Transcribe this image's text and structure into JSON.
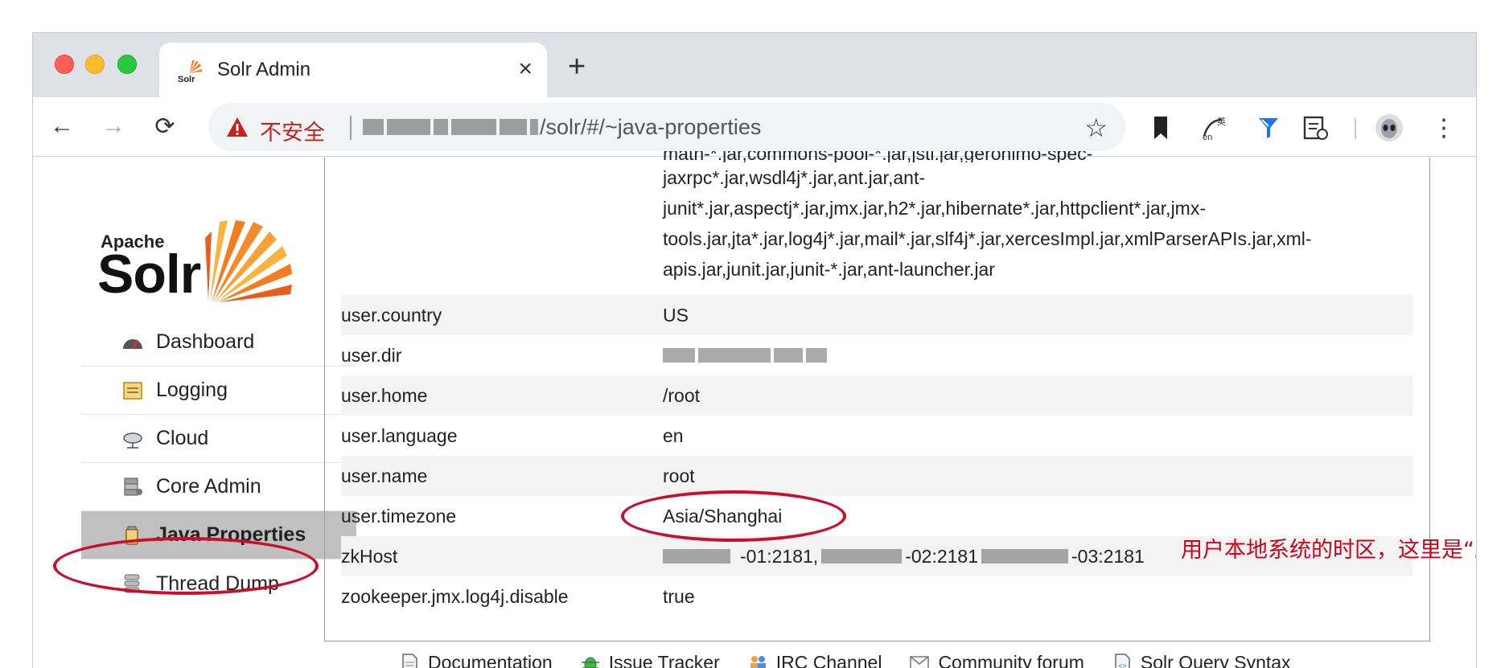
{
  "tab": {
    "title": "Solr Admin",
    "close": "×",
    "new": "+"
  },
  "omnibox": {
    "insecure_label": "不安全",
    "url_path": "/solr/#/~java-properties"
  },
  "toolbar": {
    "back": "←",
    "forward": "→",
    "reload": "⟳",
    "star": "☆",
    "menu": "⋮"
  },
  "logo": {
    "apache": "Apache",
    "solr": "Solr"
  },
  "menu": {
    "items": [
      {
        "label": "Dashboard",
        "icon": "dashboard-icon"
      },
      {
        "label": "Logging",
        "icon": "logging-icon"
      },
      {
        "label": "Cloud",
        "icon": "cloud-icon"
      },
      {
        "label": "Core Admin",
        "icon": "core-admin-icon"
      },
      {
        "label": "Java Properties",
        "icon": "java-properties-icon",
        "active": true
      },
      {
        "label": "Thread Dump",
        "icon": "thread-dump-icon"
      }
    ]
  },
  "properties": {
    "continued_lines": [
      "math-*.jar,commons-pool-*.jar,jstl.jar,geronimo-spec-",
      "jaxrpc*.jar,wsdl4j*.jar,ant.jar,ant-",
      "junit*.jar,aspectj*.jar,jmx.jar,h2*.jar,hibernate*.jar,httpclient*.jar,jmx-",
      "tools.jar,jta*.jar,log4j*.jar,mail*.jar,slf4j*.jar,xercesImpl.jar,xmlParserAPIs.jar,xml-",
      "apis.jar,junit.jar,junit-*.jar,ant-launcher.jar"
    ],
    "rows": [
      {
        "key": "user.country",
        "value": "US"
      },
      {
        "key": "user.dir",
        "value": ""
      },
      {
        "key": "user.home",
        "value": "/root"
      },
      {
        "key": "user.language",
        "value": "en"
      },
      {
        "key": "user.name",
        "value": "root"
      },
      {
        "key": "user.timezone",
        "value": "Asia/Shanghai"
      },
      {
        "key": "zkHost",
        "value": "",
        "parts": [
          "-01:2181,",
          "-02:2181",
          "-03:2181"
        ]
      },
      {
        "key": "zookeeper.jmx.log4j.disable",
        "value": "true"
      }
    ]
  },
  "annotation": {
    "text": "用户本地系统的时区，这里是“亚洲/上海”",
    "color": "#d0021b"
  },
  "footer": {
    "links": [
      {
        "label": "Documentation",
        "icon": "documentation-icon"
      },
      {
        "label": "Issue Tracker",
        "icon": "bug-icon"
      },
      {
        "label": "IRC Channel",
        "icon": "irc-icon"
      },
      {
        "label": "Community forum",
        "icon": "mail-icon"
      },
      {
        "label": "Solr Query Syntax",
        "icon": "query-syntax-icon"
      }
    ]
  },
  "colors": {
    "accent_red": "#c8102e",
    "active_menu": "#c0c0c0",
    "solr_orange": "#f47c20"
  }
}
